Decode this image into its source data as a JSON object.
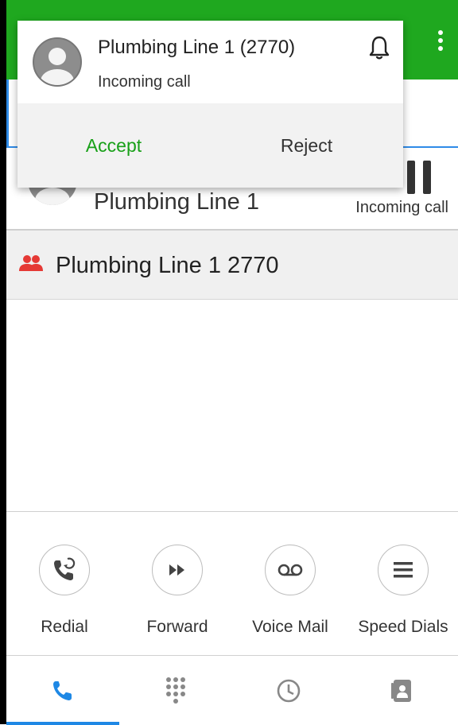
{
  "notification": {
    "title": "Plumbing Line 1 (2770)",
    "subtitle": "Incoming call",
    "accept_label": "Accept",
    "reject_label": "Reject",
    "accept_color": "#18a018"
  },
  "call": {
    "name": "Plumbing Line 1",
    "status": "Incoming call"
  },
  "group": {
    "label": "Plumbing Line 1 2770",
    "icon": "group-icon",
    "icon_color": "#e53935"
  },
  "actions": [
    {
      "label": "Redial",
      "icon": "redial-icon"
    },
    {
      "label": "Forward",
      "icon": "forward-icon"
    },
    {
      "label": "Voice Mail",
      "icon": "voicemail-icon"
    },
    {
      "label": "Speed Dials",
      "icon": "speed-dials-icon"
    }
  ],
  "bottom_nav": [
    {
      "icon": "phone-icon",
      "active": true
    },
    {
      "icon": "dialpad-icon",
      "active": false
    },
    {
      "icon": "history-icon",
      "active": false
    },
    {
      "icon": "contacts-icon",
      "active": false
    }
  ],
  "colors": {
    "topbar": "#1fa81f",
    "accent": "#1e88e5"
  }
}
